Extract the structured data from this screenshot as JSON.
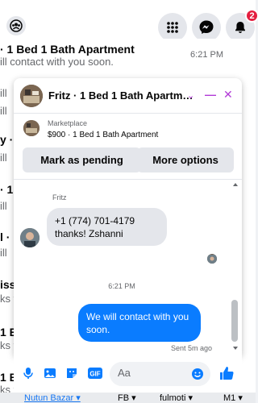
{
  "header": {
    "notification_count": "2",
    "icons": [
      "group-icon",
      "menu-grid-icon",
      "messenger-icon",
      "bell-icon"
    ]
  },
  "background_list": {
    "top_title_fragment": "· 1 Bed 1 Bath Apartment",
    "top_subtitle_fragment": "ill contact with you soon.",
    "top_time": "6:21 PM",
    "fragments": [
      {
        "text": "ill",
        "bold": false
      },
      {
        "text": "ill",
        "bold": false
      },
      {
        "text": "y ·",
        "bold": true
      },
      {
        "text": "ill",
        "bold": false
      },
      {
        "text": "· 1",
        "bold": true
      },
      {
        "text": "ill",
        "bold": false
      },
      {
        "text": "l · 1",
        "bold": true
      },
      {
        "text": "ill",
        "bold": false
      },
      {
        "text": "issa",
        "bold": true
      },
      {
        "text": "ks fo",
        "bold": false
      },
      {
        "text": "1 B",
        "bold": true
      },
      {
        "text": "ks fo",
        "bold": false
      },
      {
        "text": "1 B",
        "bold": true
      },
      {
        "text": "ks fo",
        "bold": false
      },
      {
        "text": "· 1",
        "bold": true
      }
    ]
  },
  "bottom_tabs": [
    "Nutun Bazar ▾",
    "FB ▾",
    "fulmoti ▾",
    "M1 ▾"
  ],
  "chat": {
    "title": "Fritz · 1 Bed 1 Bath Apartm…",
    "marketplace_label": "Marketplace",
    "listing": "$900 · 1 Bed 1 Bath Apartment",
    "buttons": {
      "mark_pending": "Mark as pending",
      "more_options": "More options"
    },
    "sender_name": "Fritz",
    "incoming_message": "+1 (774) 701-4179 thanks! Zshanni",
    "timestamp": "6:21 PM",
    "outgoing_message": "We will contact with you soon.",
    "sent_status": "Sent 5m ago",
    "composer": {
      "placeholder": "Aa"
    },
    "colors": {
      "accent": "#b23bd7",
      "outgoing_bubble": "#0a7cff",
      "incoming_bubble": "#e4e6eb"
    }
  }
}
